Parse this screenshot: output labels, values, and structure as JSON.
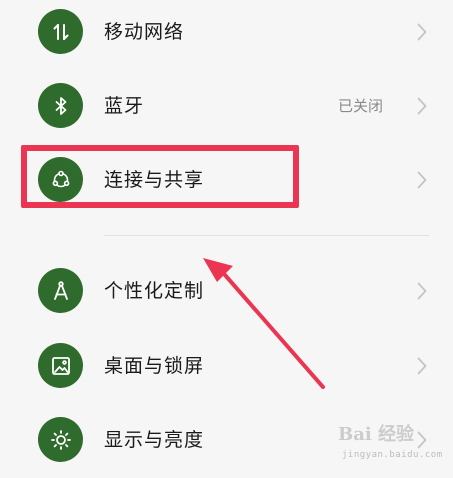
{
  "settings": {
    "items": [
      {
        "id": "mobile-network",
        "label": "移动网络",
        "value": "",
        "icon": "arrows-up-down-icon"
      },
      {
        "id": "bluetooth",
        "label": "蓝牙",
        "value": "已关闭",
        "icon": "bluetooth-icon"
      },
      {
        "id": "connection-sharing",
        "label": "连接与共享",
        "value": "",
        "icon": "share-nodes-icon"
      },
      {
        "id": "personalization",
        "label": "个性化定制",
        "value": "",
        "icon": "compass-drafting-icon"
      },
      {
        "id": "desktop-lockscreen",
        "label": "桌面与锁屏",
        "value": "",
        "icon": "picture-icon"
      },
      {
        "id": "display-brightness",
        "label": "显示与亮度",
        "value": "",
        "icon": "sun-icon"
      }
    ]
  },
  "colors": {
    "icon_bg": "#2f6b2c",
    "highlight": "#ea3652",
    "background": "#f6f6f6",
    "chevron": "#c4c4c4"
  },
  "watermark": {
    "text": "Bai 经验",
    "sub": "jingyan.baidu.com"
  }
}
